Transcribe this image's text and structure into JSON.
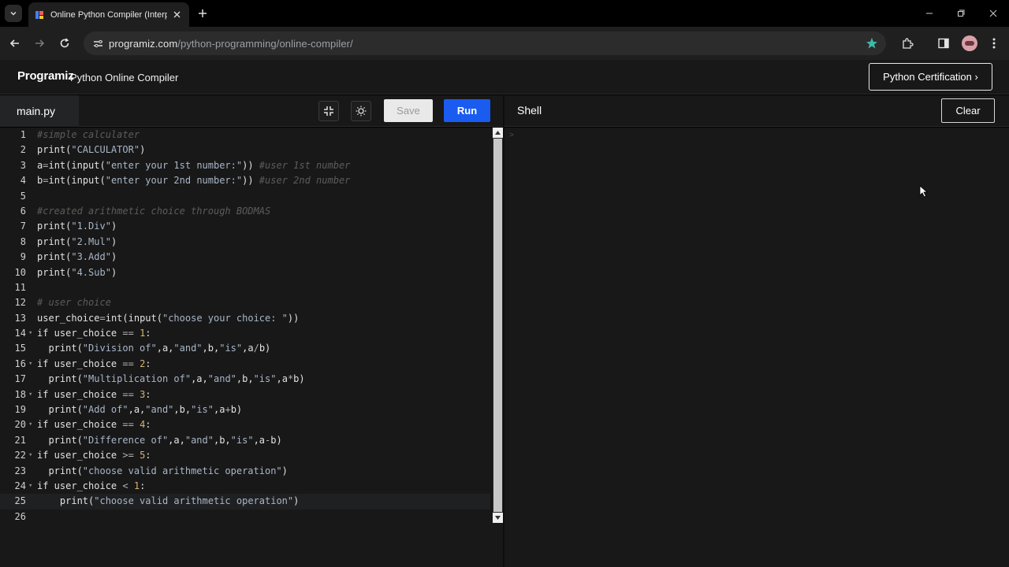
{
  "browser": {
    "tab_title": "Online Python Compiler (Interpret",
    "url_host": "programiz.com",
    "url_path": "/python-programming/online-compiler/"
  },
  "header": {
    "logo": "Programiz",
    "title": "Python Online Compiler",
    "cert_button": "Python Certification ›"
  },
  "editor": {
    "file_name": "main.py",
    "save_label": "Save",
    "run_label": "Run"
  },
  "shell": {
    "title": "Shell",
    "clear_label": "Clear",
    "prompt": ">"
  },
  "code_lines": [
    "#simple calculater",
    "print(\"CALCULATOR\")",
    "a=int(input(\"enter your 1st number:\")) #user 1st number",
    "b=int(input(\"enter your 2nd number:\")) #user 2nd number",
    "",
    "#created arithmetic choice through BODMAS",
    "print(\"1.Div\")",
    "print(\"2.Mul\")",
    "print(\"3.Add\")",
    "print(\"4.Sub\")",
    "",
    "# user choice",
    "user_choice=int(input(\"choose your choice: \"))",
    "if user_choice == 1:",
    "  print(\"Division of\",a,\"and\",b,\"is\",a/b)",
    "if user_choice == 2:",
    "  print(\"Multiplication of\",a,\"and\",b,\"is\",a*b)",
    "if user_choice == 3:",
    "  print(\"Add of\",a,\"and\",b,\"is\",a+b)",
    "if user_choice == 4:",
    "  print(\"Difference of\",a,\"and\",b,\"is\",a-b)",
    "if user_choice >= 5:",
    "  print(\"choose valid arithmetic operation\")",
    "if user_choice < 1:",
    "    print(\"choose valid arithmetic operation\")",
    ""
  ],
  "active_line": 25,
  "colors": {
    "run_button": "#1a5cf0",
    "star": "#3fb8a8",
    "panel_bg": "#181818"
  }
}
